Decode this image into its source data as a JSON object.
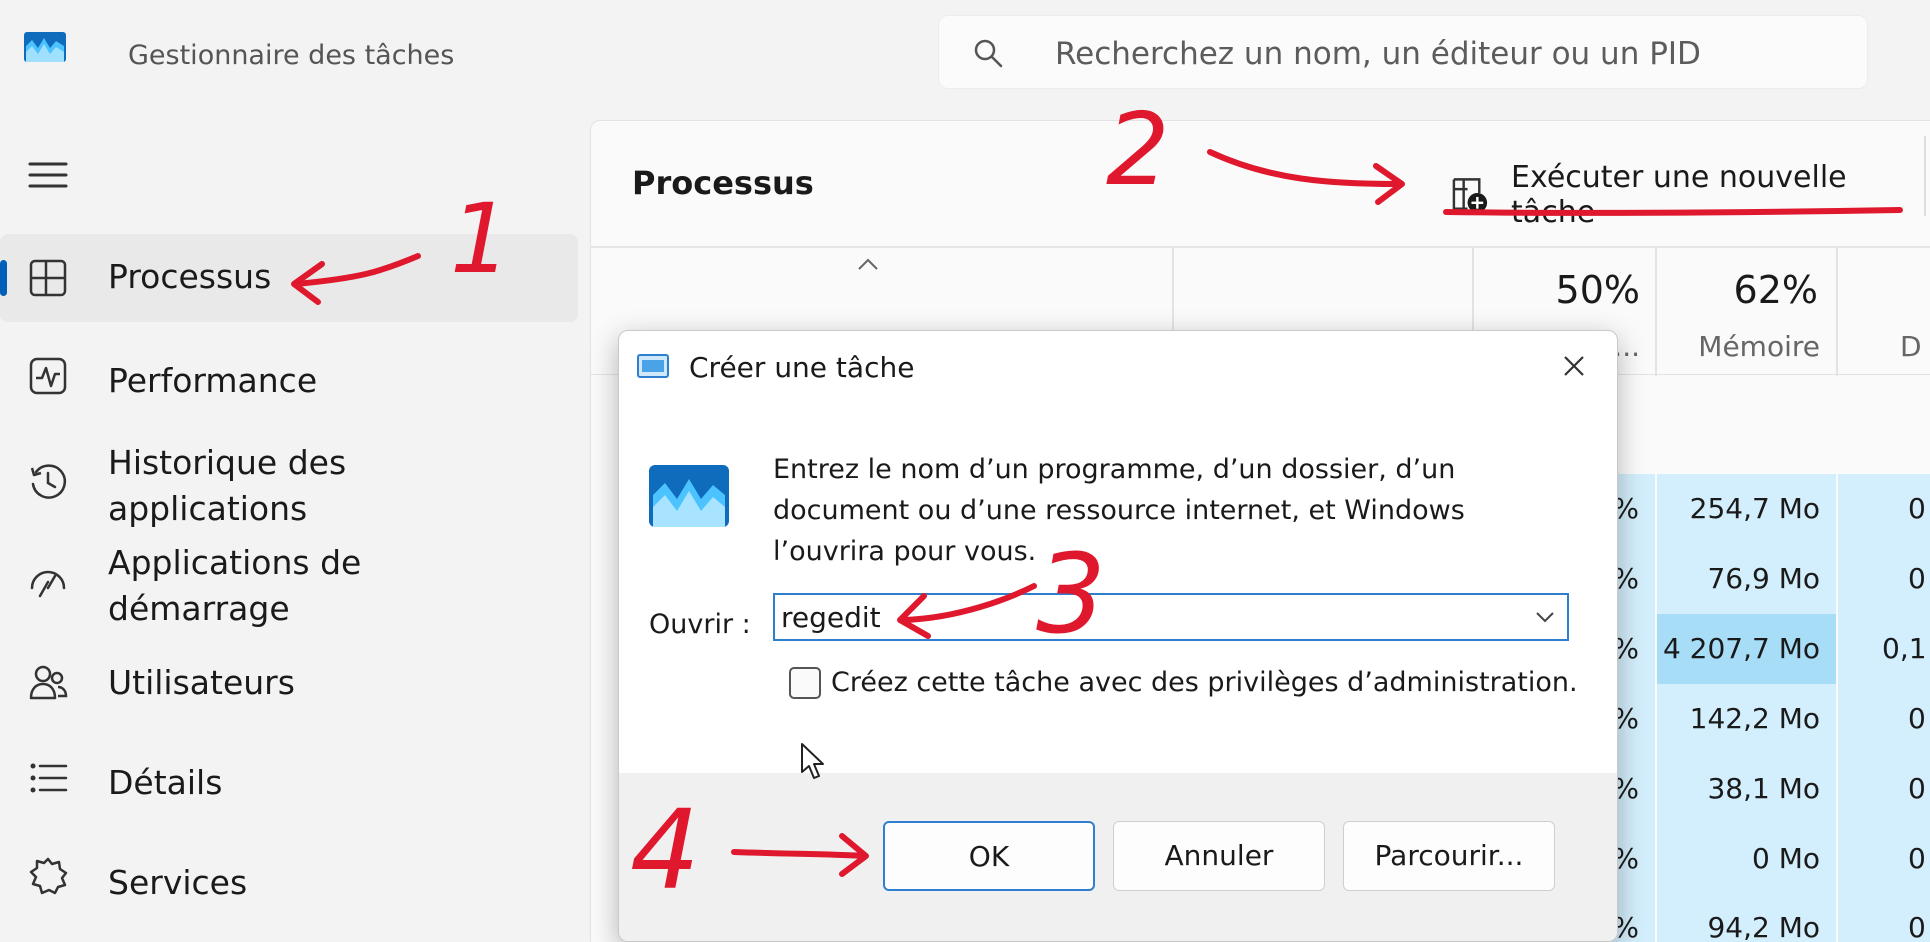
{
  "app": {
    "title": "Gestionnaire des tâches"
  },
  "search": {
    "placeholder": "Recherchez un nom, un éditeur ou un PID"
  },
  "sidebar": {
    "items": [
      {
        "label": "Processus",
        "icon": "processes-icon",
        "active": true
      },
      {
        "label": "Performance",
        "icon": "performance-icon"
      },
      {
        "label": "Historique des applications",
        "icon": "history-icon"
      },
      {
        "label": "Applications de démarrage",
        "icon": "startup-icon"
      },
      {
        "label": "Utilisateurs",
        "icon": "users-icon"
      },
      {
        "label": "Détails",
        "icon": "details-list-icon"
      },
      {
        "label": "Services",
        "icon": "services-gear-icon"
      }
    ]
  },
  "main": {
    "title": "Processus",
    "run_task_label": "Exécuter une nouvelle tâche",
    "columns": {
      "cpu_pct": "50%",
      "cpu_name_truncated": "...",
      "memory_pct": "62%",
      "memory_name": "Mémoire",
      "disk_name_truncated": "D"
    },
    "rows": [
      {
        "cpu": "%",
        "memory": "254,7 Mo",
        "disk": "0"
      },
      {
        "cpu": "%",
        "memory": "76,9 Mo",
        "disk": "0"
      },
      {
        "cpu": "%",
        "memory": "4 207,7 Mo",
        "disk": "0,1"
      },
      {
        "cpu": "%",
        "memory": "142,2 Mo",
        "disk": "0"
      },
      {
        "cpu": "%",
        "memory": "38,1 Mo",
        "disk": "0"
      },
      {
        "cpu": "%",
        "memory": "0 Mo",
        "disk": "0"
      },
      {
        "cpu": "%",
        "memory": "94,2 Mo",
        "disk": "0"
      }
    ]
  },
  "dialog": {
    "title": "Créer une tâche",
    "description": "Entrez le nom d’un programme, d’un dossier, d’un document ou d’une ressource internet, et Windows l’ouvrira pour vous.",
    "open_label": "Ouvrir :",
    "open_value": "regedit",
    "admin_checkbox_label": "Créez cette tâche avec des privilèges d’administration.",
    "ok_label": "OK",
    "cancel_label": "Annuler",
    "browse_label": "Parcourir..."
  },
  "annotations": {
    "step1": "1",
    "step2": "2",
    "step3": "3",
    "step4": "4",
    "color": "#e0182d"
  },
  "colors": {
    "accent": "#005fb8",
    "heat_light": "#d3eefc",
    "heat_medium": "#a8ddf7"
  }
}
